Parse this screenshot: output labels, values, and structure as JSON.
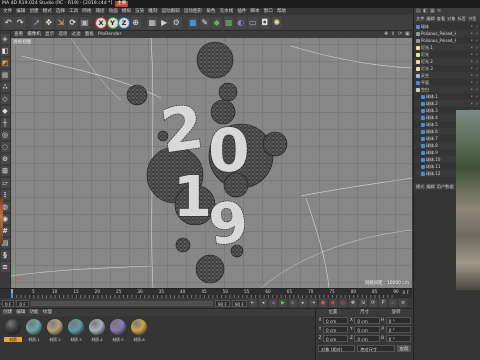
{
  "window": {
    "title": "MA 4D R19.024 Studio (RC - R19) - [2019.c4d *]",
    "badge": "主要"
  },
  "menu": {
    "items": [
      "文件",
      "编辑",
      "创建",
      "模式",
      "选择",
      "工具",
      "网格",
      "捕捉",
      "动画",
      "模拟",
      "渲染",
      "雕刻",
      "运动跟踪",
      "运动图形",
      "角色",
      "流水线",
      "插件",
      "脚本",
      "窗口",
      "帮助"
    ]
  },
  "toolbar": {
    "icons": [
      {
        "name": "undo-icon",
        "glyph": "↶",
        "color": "#cfcfcf"
      },
      {
        "name": "redo-icon",
        "glyph": "↷",
        "color": "#cfcfcf"
      },
      {
        "name": "live-select-icon",
        "glyph": "➚",
        "color": "#8ec0f0"
      },
      {
        "name": "move-icon",
        "glyph": "✥",
        "color": "#e0e0e0"
      },
      {
        "name": "scale-icon",
        "glyph": "⇲",
        "color": "#e8a040"
      },
      {
        "name": "rotate-icon",
        "glyph": "⟳",
        "color": "#e0e0e0"
      },
      {
        "name": "recent-tool-icon",
        "glyph": "▣",
        "color": "#bdbdbd"
      },
      {
        "name": "x-axis-lock-icon",
        "glyph": "X",
        "color": "#c0392b",
        "axis": true
      },
      {
        "name": "y-axis-lock-icon",
        "glyph": "Y",
        "color": "#3a9a3a",
        "axis": true
      },
      {
        "name": "z-axis-lock-icon",
        "glyph": "Z",
        "color": "#2d6fc0",
        "axis": true
      },
      {
        "name": "coordinate-system-icon",
        "glyph": "⊕",
        "color": "#d0d0d0"
      },
      {
        "name": "render-view-icon",
        "glyph": "▦",
        "color": "#d0d0d0"
      },
      {
        "name": "render-to-picture-viewer-icon",
        "glyph": "▶",
        "color": "#d0d0d0"
      },
      {
        "name": "render-settings-icon",
        "glyph": "⚙",
        "color": "#d0d0d0"
      },
      {
        "name": "cube-icon",
        "glyph": "■",
        "color": "#4a8fd6"
      },
      {
        "name": "pen-icon",
        "glyph": "✎",
        "color": "#e0e0e0"
      },
      {
        "name": "subdivision-surface-icon",
        "glyph": "◆",
        "color": "#5fb55f"
      },
      {
        "name": "cloner-icon",
        "glyph": "▩",
        "color": "#5fb55f"
      },
      {
        "name": "deformer-icon",
        "glyph": "◐",
        "color": "#9b7ad0"
      },
      {
        "name": "floor-icon",
        "glyph": "▭",
        "color": "#bdbdbd"
      },
      {
        "name": "camera-icon",
        "glyph": "◘",
        "color": "#e0e0e0"
      },
      {
        "name": "light-icon",
        "glyph": "✺",
        "color": "#f0e0a0"
      }
    ]
  },
  "left_toolbar": {
    "icons": [
      {
        "name": "make-editable-icon",
        "glyph": "◈",
        "color": "#bdbdbd"
      },
      {
        "name": "model-mode-icon",
        "glyph": "◧",
        "color": "#e0e0e0"
      },
      {
        "name": "texture-mode-icon",
        "glyph": "◩",
        "color": "#e8a040"
      },
      {
        "name": "workplane-mode-icon",
        "glyph": "▦",
        "color": "#bdbdbd"
      },
      {
        "name": "points-mode-icon",
        "glyph": "∴",
        "color": "#e0e0e0"
      },
      {
        "name": "edges-mode-icon",
        "glyph": "◇",
        "color": "#e0e0e0"
      },
      {
        "name": "polygons-mode-icon",
        "glyph": "◆",
        "color": "#e0e0e0"
      },
      {
        "name": "axis-mode-icon",
        "glyph": "┼",
        "color": "#e0e0e0"
      },
      {
        "name": "tweak-mode-icon",
        "glyph": "◎",
        "color": "#e0e0e0"
      },
      {
        "name": "soft-selection-icon",
        "glyph": "◌",
        "color": "#e0e0e0"
      },
      {
        "name": "snap-icon",
        "glyph": "⊙",
        "color": "#e0e0e0"
      },
      {
        "name": "workplane-lock-icon",
        "glyph": "⊞",
        "color": "#e0e0e0"
      },
      {
        "name": "planar-workplane-icon",
        "glyph": "▱",
        "color": "#e0e0e0"
      },
      {
        "name": "quantize-icon",
        "glyph": "⋮",
        "color": "#e0e0e0"
      },
      {
        "name": "solo-icon",
        "glyph": "◍",
        "color": "#e0e0e0"
      },
      {
        "name": "viewport-solo-icon",
        "glyph": "◉",
        "color": "#e0e0e0"
      },
      {
        "name": "grid-icon",
        "glyph": "#",
        "color": "#e0e0e0"
      },
      {
        "name": "layout-icon",
        "glyph": "▤",
        "color": "#e0e0e0"
      },
      {
        "name": "script-icon",
        "glyph": "§",
        "color": "#e0e0e0"
      },
      {
        "name": "dopesheet-icon",
        "glyph": "≡",
        "color": "#e0e0e0"
      }
    ]
  },
  "viewport": {
    "menu": [
      "查看",
      "摄像机",
      "显示",
      "选项",
      "过滤",
      "面板",
      "ProRender"
    ],
    "view_name": "透视视图",
    "grid_spacing": "网格间距 : 10000 cm",
    "digits": [
      "2",
      "0",
      "1",
      "9"
    ]
  },
  "timeline": {
    "ticks": [
      "0",
      "5",
      "10",
      "15",
      "20",
      "25",
      "30",
      "35",
      "40",
      "45",
      "50",
      "55",
      "60",
      "65",
      "70",
      "75",
      "80",
      "85",
      "90"
    ],
    "current_frame": "0 F"
  },
  "transport": {
    "start": "0 F",
    "current": "0 F",
    "end": "90 F",
    "max": "90 F"
  },
  "materials": {
    "menu": [
      "创建",
      "编辑",
      "功能",
      "纹理"
    ],
    "items": [
      {
        "name": "材质",
        "color": "#3a3a3a",
        "selected": true
      },
      {
        "name": "材质.1",
        "color": "#6aa8a8"
      },
      {
        "name": "材质.2",
        "color": "#b9a27a"
      },
      {
        "name": "材质.3",
        "color": "#5f9aa6"
      },
      {
        "name": "材质.4",
        "color": "#a8b0b8"
      },
      {
        "name": "材质.5",
        "color": "#8a78b0"
      },
      {
        "name": "材质.6",
        "color": "#c9a44a"
      }
    ]
  },
  "coordinates": {
    "headers": [
      "位置",
      "尺寸",
      "旋转"
    ],
    "rows": [
      {
        "axis": "X",
        "position": "0 cm",
        "size_axis": "X",
        "size": "0 cm",
        "rot_axis": "H",
        "rotation": "0 °"
      },
      {
        "axis": "Y",
        "position": "0 cm",
        "size_axis": "Y",
        "size": "0 cm",
        "rot_axis": "P",
        "rotation": "0 °"
      },
      {
        "axis": "Z",
        "position": "0 cm",
        "size_axis": "Z",
        "size": "0 cm",
        "rot_axis": "B",
        "rotation": "0 °"
      }
    ],
    "mode": "对象 (相对)",
    "size_mode": "绝对尺寸",
    "apply": "应用"
  },
  "objects": {
    "menu": [
      "文件",
      "编辑",
      "查看",
      "对象",
      "标签",
      "书签"
    ],
    "items": [
      {
        "name": "球体",
        "color": "#4a8fd6",
        "level": 0
      },
      {
        "name": "Polianus_Poised_HiR_M",
        "color": "#9a9a9a",
        "level": 0
      },
      {
        "name": "Polianus_Poised_HiR_M",
        "color": "#9a9a9a",
        "level": 0
      },
      {
        "name": "灯光.1",
        "color": "#f0e0a0",
        "level": 0
      },
      {
        "name": "灯光",
        "color": "#f0e0a0",
        "level": 0
      },
      {
        "name": "灯光.2",
        "color": "#f0e0a0",
        "level": 0
      },
      {
        "name": "灯光.3",
        "color": "#f0e0a0",
        "level": 0
      },
      {
        "name": "天空",
        "color": "#8ec0f0",
        "level": 0
      },
      {
        "name": "平面",
        "color": "#4a8fd6",
        "level": 0
      },
      {
        "name": "空白",
        "color": "#cfcfcf",
        "level": 0
      },
      {
        "name": "球体.1",
        "color": "#4a8fd6",
        "level": 1
      },
      {
        "name": "球体.2",
        "color": "#4a8fd6",
        "level": 1
      },
      {
        "name": "球体.3",
        "color": "#4a8fd6",
        "level": 1
      },
      {
        "name": "球体.4",
        "color": "#4a8fd6",
        "level": 1
      },
      {
        "name": "球体.5",
        "color": "#4a8fd6",
        "level": 1
      },
      {
        "name": "球体.6",
        "color": "#4a8fd6",
        "level": 1
      },
      {
        "name": "球体.7",
        "color": "#4a8fd6",
        "level": 1
      },
      {
        "name": "球体.8",
        "color": "#4a8fd6",
        "level": 1
      },
      {
        "name": "球体.9",
        "color": "#4a8fd6",
        "level": 1
      },
      {
        "name": "球体.10",
        "color": "#4a8fd6",
        "level": 1
      },
      {
        "name": "球体.11",
        "color": "#4a8fd6",
        "level": 1
      },
      {
        "name": "球体.12",
        "color": "#4a8fd6",
        "level": 1
      }
    ]
  },
  "attributes": {
    "menu": [
      "模式",
      "编辑",
      "用户数据"
    ]
  }
}
